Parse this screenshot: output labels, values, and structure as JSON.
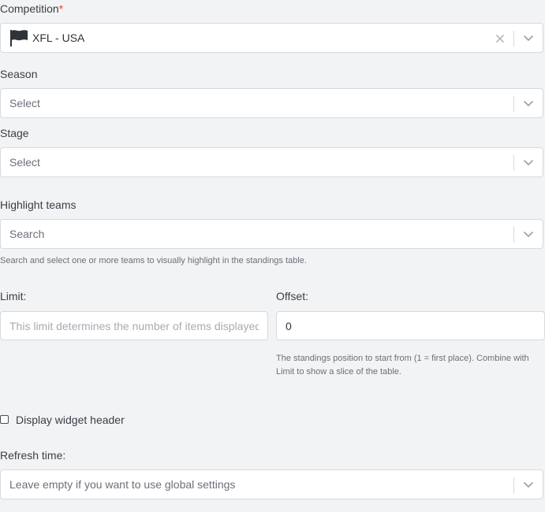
{
  "competition": {
    "label": "Competition",
    "required_mark": "*",
    "value": "XFL - USA",
    "icon": "flag-icon"
  },
  "season": {
    "label": "Season",
    "placeholder": "Select"
  },
  "stage": {
    "label": "Stage",
    "placeholder": "Select"
  },
  "highlight_teams": {
    "label": "Highlight teams",
    "placeholder": "Search",
    "hint": "Search and select one or more teams to visually highlight in the standings table."
  },
  "limit": {
    "label": "Limit:",
    "placeholder": "This limit determines the number of items displayed",
    "value": ""
  },
  "offset": {
    "label": "Offset:",
    "value": "0",
    "hint": "The standings position to start from (1 = first place). Combine with Limit to show a slice of the table."
  },
  "display_header": {
    "label": "Display widget header",
    "checked": false
  },
  "refresh_time": {
    "label": "Refresh time:",
    "placeholder": "Leave empty if you want to use global settings"
  },
  "colors": {
    "background": "#f2f3f5",
    "border": "#d6d9de",
    "required": "#e0443c",
    "flag": "#2f343b"
  }
}
